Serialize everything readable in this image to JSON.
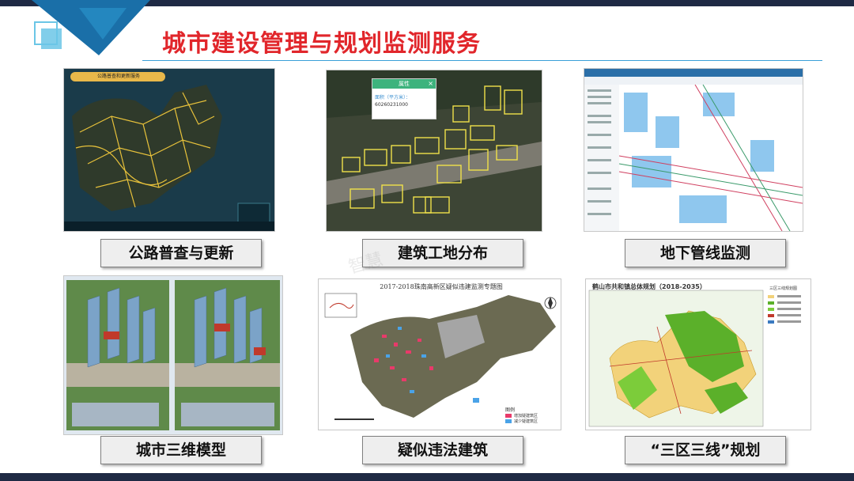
{
  "page": {
    "title": "城市建设管理与规划监测服务",
    "watermark": "智慧"
  },
  "panels": [
    {
      "caption": "公路普查与更新",
      "header": "公路普查和更新服务"
    },
    {
      "caption": "建筑工地分布",
      "popup_title": "属性",
      "popup_label": "面积（平方米）：",
      "popup_value": "60260231000"
    },
    {
      "caption": "地下管线监测"
    },
    {
      "caption": "城市三维模型"
    },
    {
      "caption": "疑似违法建筑",
      "map_title": "2017-2018珠南高新区疑似违建监测专题图",
      "legend_title": "图例",
      "legend_items": [
        "增加疑建筑区",
        "减少疑建筑区"
      ]
    },
    {
      "caption": "“三区三线”规划",
      "map_title": "鹤山市共和镇总体规划（2018-2035）",
      "legend_title": "三区三线规划图"
    }
  ],
  "colors": {
    "title": "#e1262b",
    "accent": "#3aa0d8",
    "bar": "#1f2a44"
  }
}
